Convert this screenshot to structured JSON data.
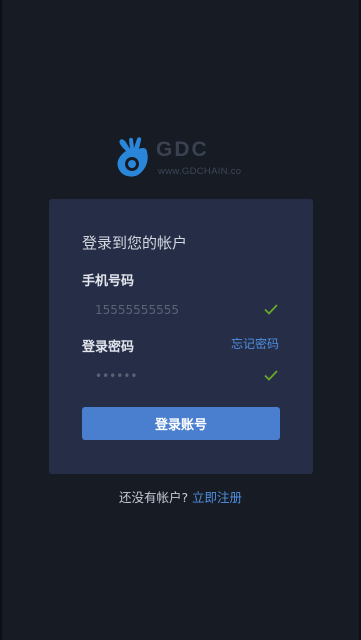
{
  "logo": {
    "wordmark": "GDC",
    "url": "www.GDCHAIN.co",
    "brand_color": "#2a86d8"
  },
  "login_card": {
    "title": "登录到您的帐户",
    "phone": {
      "label": "手机号码",
      "placeholder": "15555555555",
      "icon": "check-icon"
    },
    "password": {
      "label": "登录密码",
      "placeholder": "••••••",
      "forgot_label": "忘记密码",
      "icon": "check-icon"
    },
    "submit_label": "登录账号"
  },
  "register": {
    "prompt": "还没有帐户? ",
    "link_label": "立即注册"
  },
  "colors": {
    "background": "#161b24",
    "card": "#252d47",
    "accent": "#4a7fd0",
    "link": "#4f8fe0",
    "check": "#6aa92a"
  }
}
